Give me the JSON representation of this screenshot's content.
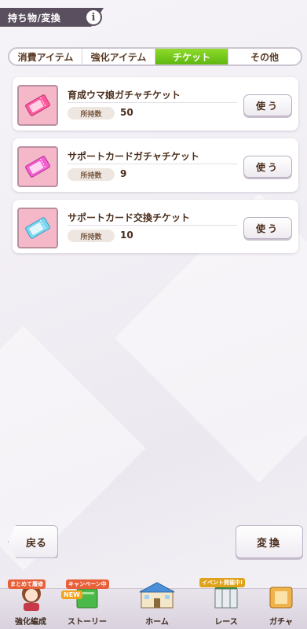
{
  "header": {
    "title": "持ち物/変換",
    "info_icon": "info-icon"
  },
  "tabs": [
    {
      "label": "消費アイテム",
      "active": false
    },
    {
      "label": "強化アイテム",
      "active": false
    },
    {
      "label": "チケット",
      "active": true
    },
    {
      "label": "その他",
      "active": false
    }
  ],
  "tickets": [
    {
      "name": "育成ウマ娘ガチャチケット",
      "owned_label": "所持数",
      "count": "50",
      "use_label": "使う",
      "icon": "ticket-pink-icon"
    },
    {
      "name": "サポートカードガチャチケット",
      "owned_label": "所持数",
      "count": "9",
      "use_label": "使う",
      "icon": "ticket-magenta-icon"
    },
    {
      "name": "サポートカード交換チケット",
      "owned_label": "所持数",
      "count": "10",
      "use_label": "使う",
      "icon": "ticket-blue-icon"
    }
  ],
  "actions": {
    "back_label": "戻る",
    "exchange_label": "変換"
  },
  "footer": {
    "items": [
      {
        "label": "強化編成",
        "badge": "まとめて履修"
      },
      {
        "label": "ストーリー",
        "badge": "キャンペーン中",
        "new_badge": "NEW"
      },
      {
        "label": "ホーム"
      },
      {
        "label": "レース",
        "badge": "イベント開催中!"
      },
      {
        "label": "ガチャ"
      }
    ]
  },
  "colors": {
    "active_tab": "#6cc41a",
    "header_bg": "#5a4f5e",
    "ticket_frame": "#f4b8c8"
  }
}
